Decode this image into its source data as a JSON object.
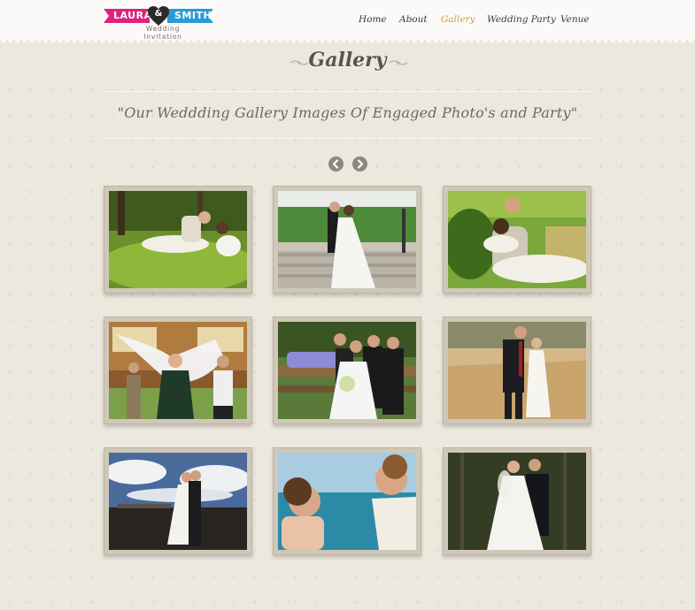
{
  "logo": {
    "name_left": "LAURA",
    "ampersand": "&",
    "name_right": "SMITH",
    "subtitle": "Wedding Invitation",
    "colors": {
      "left_band": "#e0237d",
      "right_band": "#2a9ad8",
      "heart": "#2c2a28"
    }
  },
  "nav": {
    "items": [
      {
        "label": "Home",
        "active": false
      },
      {
        "label": "About",
        "active": false
      },
      {
        "label": "Gallery",
        "active": true
      },
      {
        "label": "Wedding Party",
        "active": false
      },
      {
        "label": "Venue",
        "active": false
      }
    ],
    "active_color": "#c9a23a"
  },
  "page": {
    "title": "Gallery",
    "subtitle": "\"Our Weddding Gallery Images Of Engaged Photo's and Party\""
  },
  "carousel": {
    "prev_icon": "chevron-left-icon",
    "next_icon": "chevron-right-icon"
  },
  "gallery": {
    "photos": [
      {
        "subject": "couple-lying-in-grass"
      },
      {
        "subject": "couple-on-park-steps"
      },
      {
        "subject": "couple-relaxing-outdoors"
      },
      {
        "subject": "bride-with-veil-and-guests"
      },
      {
        "subject": "wedding-party-group"
      },
      {
        "subject": "couple-in-wheat-field"
      },
      {
        "subject": "couple-under-cloudy-sky"
      },
      {
        "subject": "couple-by-the-sea"
      },
      {
        "subject": "couple-in-dark-forest"
      }
    ]
  }
}
